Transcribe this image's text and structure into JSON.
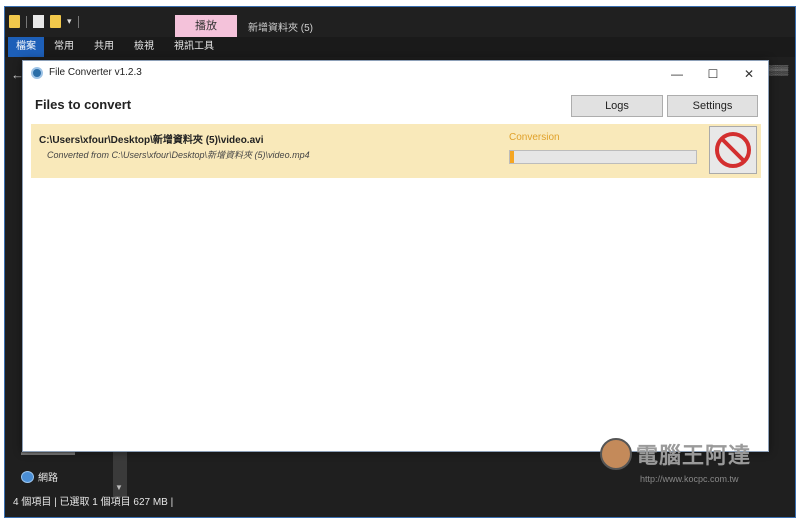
{
  "explorer": {
    "tab_play": "播放",
    "title": "新增資料夾 (5)",
    "ribbon_tabs": [
      "檔案",
      "常用",
      "共用",
      "檢視",
      "視訊工具"
    ],
    "nav_network": "網路",
    "status": "4 個項目  |  已選取 1 個項目  627 MB  |"
  },
  "app": {
    "window_title": "File Converter v1.2.3",
    "heading": "Files to convert",
    "logs_label": "Logs",
    "settings_label": "Settings"
  },
  "conversion": {
    "output_path": "C:\\Users\\xfour\\Desktop\\新增資料夾 (5)\\video.avi",
    "source_text": "Converted from  C:\\Users\\xfour\\Desktop\\新增資料夾 (5)\\video.mp4",
    "status": "Conversion",
    "progress_percent": 2
  },
  "watermark": {
    "text": "電腦王阿達",
    "url": "http://www.kocpc.com.tw"
  },
  "colors": {
    "accent": "#1d5fb8",
    "row_bg": "#f9e9ba",
    "status_orange": "#e0a12a",
    "progress_fill": "#f5a623",
    "cancel_red": "#d32f2f"
  },
  "icons": {
    "cancel": "cancel-icon",
    "app": "file-converter-icon"
  }
}
